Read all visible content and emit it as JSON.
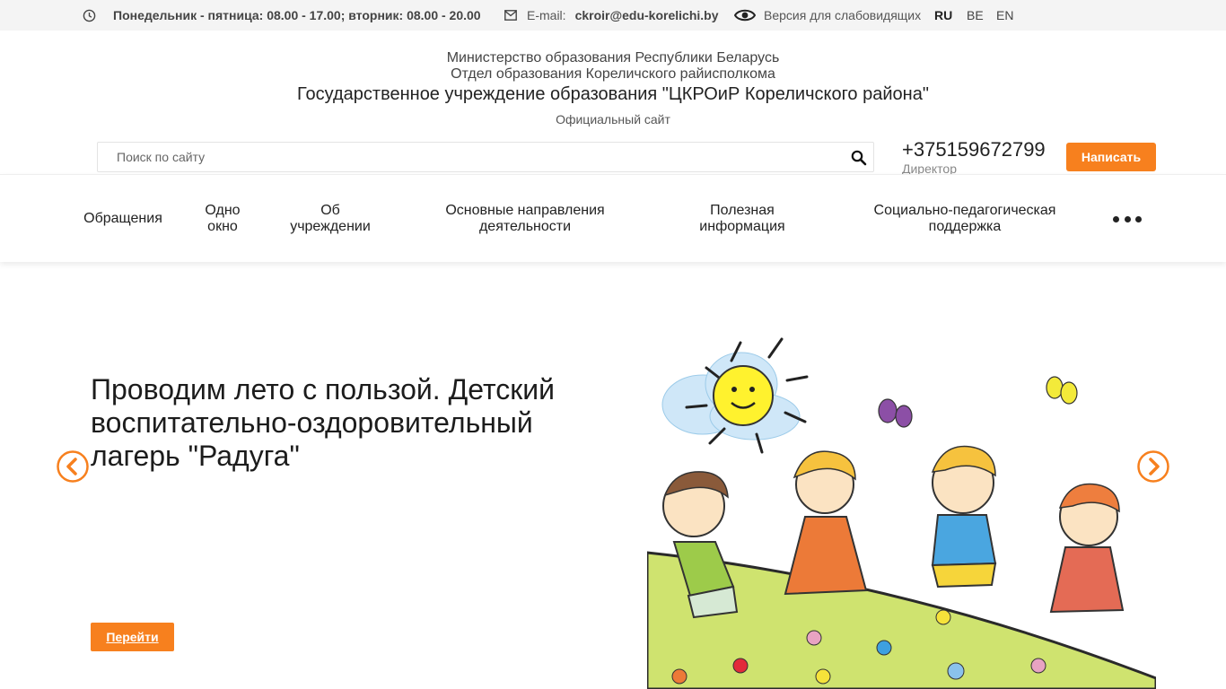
{
  "topbar": {
    "hours": "Понедельник - пятница: 08.00 - 17.00; вторник: 08.00 - 20.00",
    "email_label": "E-mail:",
    "email": "ckroir@edu-korelichi.by",
    "vision": "Версия для слабовидящих",
    "languages": [
      "RU",
      "BE",
      "EN"
    ],
    "active_language": "RU"
  },
  "header": {
    "line1": "Министерство образования Республики Беларусь",
    "line2": "Отдел образования Кореличского райисполкома",
    "title": "Государственное учреждение образования \"ЦКРОиР Кореличского района\"",
    "subtitle": "Официальный сайт"
  },
  "search": {
    "placeholder": "Поиск по сайту",
    "value": ""
  },
  "contact": {
    "phone": "+375159672799",
    "phone_role": "Директор",
    "write_label": "Написать"
  },
  "nav": {
    "items": [
      {
        "label": "Обращения"
      },
      {
        "label": "Одно окно"
      },
      {
        "label": "Об учреждении"
      },
      {
        "label": "Основные направления деятельности"
      },
      {
        "label": "Полезная информация"
      },
      {
        "label": "Социально-педагогическая поддержка"
      }
    ]
  },
  "slider": {
    "title": "Проводим лето с пользой. Детский воспитательно-оздоровительный лагерь \"Радуга\"",
    "button": "Перейти"
  },
  "colors": {
    "accent": "#f7801e",
    "topbar_bg": "#f4f4f4"
  },
  "icons": [
    "clock-icon",
    "mail-icon",
    "eye-icon",
    "search-icon",
    "more-dots-icon",
    "arrow-left-icon",
    "arrow-right-icon"
  ]
}
